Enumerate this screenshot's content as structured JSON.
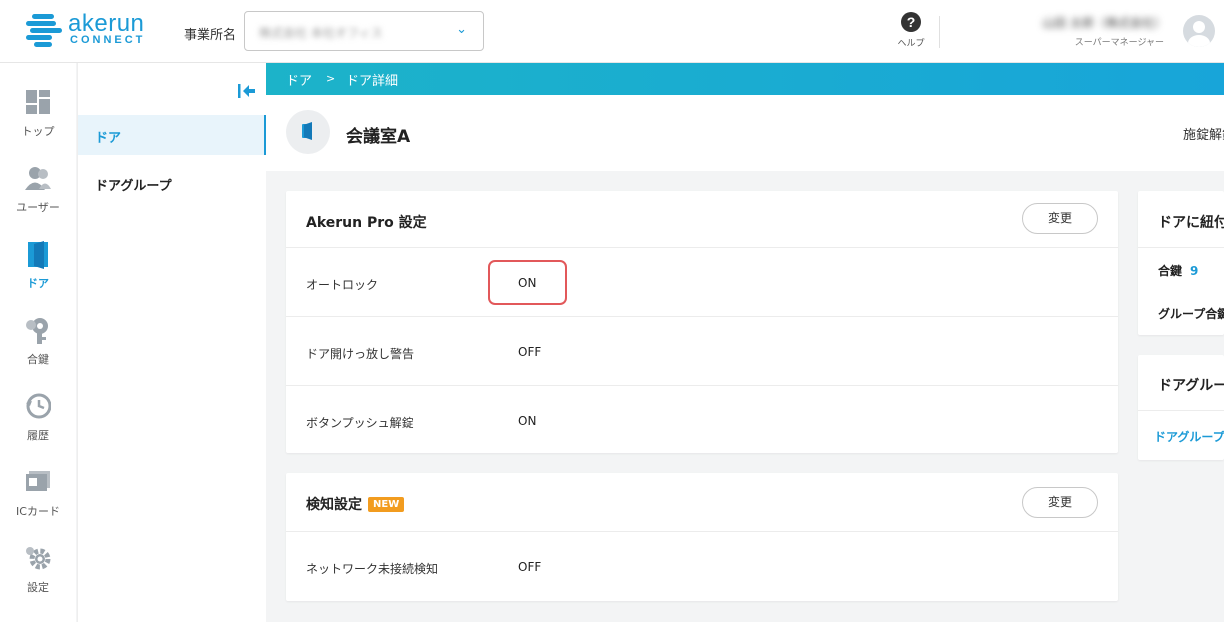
{
  "header": {
    "logo_word": "akerun",
    "logo_sub": "CONNECT",
    "office_label": "事業所名",
    "office_value": "株式会社 本社オフィス",
    "help_label": "ヘルプ",
    "user_name": "山田 太郎（株式会社）",
    "user_role": "スーパーマネージャー"
  },
  "rail": {
    "items": [
      {
        "label": "トップ",
        "icon": "dashboard-icon"
      },
      {
        "label": "ユーザー",
        "icon": "users-icon"
      },
      {
        "label": "ドア",
        "icon": "door-icon"
      },
      {
        "label": "合鍵",
        "icon": "key-icon"
      },
      {
        "label": "履歴",
        "icon": "history-icon"
      },
      {
        "label": "ICカード",
        "icon": "ic-card-icon"
      },
      {
        "label": "設定",
        "icon": "gear-icon"
      }
    ],
    "active_color": "#1b9ad6"
  },
  "subnav": {
    "items": [
      {
        "label": "ドア"
      },
      {
        "label": "ドアグループ"
      }
    ]
  },
  "breadcrumb": {
    "root": "ドア",
    "sep": ">",
    "current": "ドア詳細"
  },
  "door": {
    "name": "会議室A",
    "right_text": "施錠解錠"
  },
  "pro_settings": {
    "title": "Akerun Pro 設定",
    "change_label": "変更",
    "rows": [
      {
        "key": "オートロック",
        "value": "ON"
      },
      {
        "key": "ドア開けっ放し警告",
        "value": "OFF"
      },
      {
        "key": "ボタンプッシュ解錠",
        "value": "ON"
      }
    ]
  },
  "detect_settings": {
    "title": "検知設定",
    "badge": "NEW",
    "change_label": "変更",
    "rows": [
      {
        "key": "ネットワーク未接続検知",
        "value": "OFF"
      }
    ]
  },
  "linked": {
    "title": "ドアに紐付",
    "spare_key_label": "合鍵",
    "spare_key_count": "9",
    "group_label": "グループ合鍵"
  },
  "door_group": {
    "title": "ドアグループ",
    "link": "ドアグループ"
  },
  "colors": {
    "brand": "#1b9ad6",
    "highlight": "#e2585a",
    "badge_new": "#f29c1f"
  }
}
